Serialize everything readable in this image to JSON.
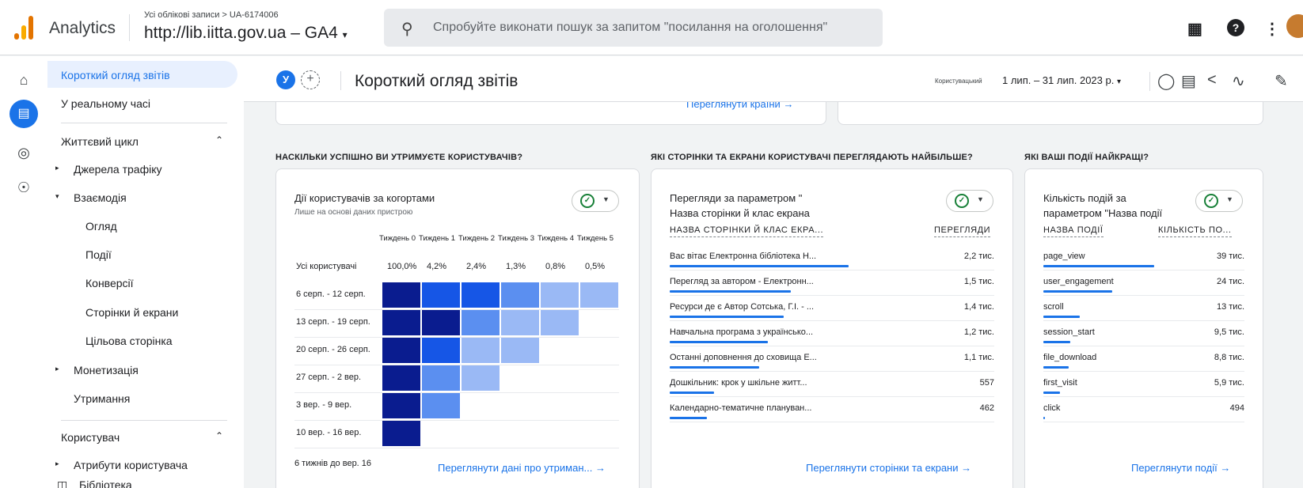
{
  "topbar": {
    "app_name": "Analytics",
    "breadcrumb": "Усі облікові записи > UA-6174006",
    "property": "http://lib.iitta.gov.ua – GA4",
    "search_placeholder": "Спробуйте виконати пошук за запитом \"посилання на оголошення\""
  },
  "sidebar": {
    "items": [
      {
        "label": "Короткий огляд звітів"
      },
      {
        "label": "У реальному часі"
      },
      {
        "label": "Життєвий цикл"
      },
      {
        "label": "Джерела трафіку"
      },
      {
        "label": "Взаємодія"
      },
      {
        "label": "Огляд"
      },
      {
        "label": "Події"
      },
      {
        "label": "Конверсії"
      },
      {
        "label": "Сторінки й екрани"
      },
      {
        "label": "Цільова сторінка"
      },
      {
        "label": "Монетизація"
      },
      {
        "label": "Утримання"
      },
      {
        "label": "Користувач"
      },
      {
        "label": "Атрибути користувача"
      },
      {
        "label": "Бібліотека"
      }
    ]
  },
  "header": {
    "chip_letter": "У",
    "title": "Короткий огляд звітів",
    "custom_label": "Користувацький",
    "date_range": "1 лип. – 31 лип. 2023 р."
  },
  "top_link": "Переглянути країни",
  "sections": {
    "retention": "НАСКІЛЬКИ УСПІШНО ВИ УТРИМУЄТЕ КОРИСТУВАЧІВ?",
    "pages": "ЯКІ СТОРІНКИ ТА ЕКРАНИ КОРИСТУВАЧІ ПЕРЕГЛЯДАЮТЬ НАЙБІЛЬШЕ?",
    "events": "ЯКІ ВАШІ ПОДІЇ НАЙКРАЩІ?"
  },
  "cohort": {
    "title": "Дії користувачів за когортами",
    "subtitle": "Лише на основі даних пристрою",
    "week_labels": [
      "Тиждень 0",
      "Тиждень 1",
      "Тиждень 2",
      "Тиждень 3",
      "Тиждень 4",
      "Тиждень 5"
    ],
    "all_users_label": "Усі користувачі",
    "all_users_pct": [
      "100,0%",
      "4,2%",
      "2,4%",
      "1,3%",
      "0,8%",
      "0,5%"
    ],
    "cohort_rows": [
      {
        "label": "6 серп. - 12 серп.",
        "shades": [
          0,
          1,
          1,
          2,
          3,
          3
        ]
      },
      {
        "label": "13 серп. - 19 серп.",
        "shades": [
          0,
          0,
          2,
          3,
          3
        ]
      },
      {
        "label": "20 серп. - 26 серп.",
        "shades": [
          0,
          1,
          3,
          3
        ]
      },
      {
        "label": "27 серп. - 2 вер.",
        "shades": [
          0,
          2,
          3
        ]
      },
      {
        "label": "3 вер. - 9 вер.",
        "shades": [
          0,
          2
        ]
      },
      {
        "label": "10 вер. - 16 вер.",
        "shades": [
          0
        ]
      }
    ],
    "shade_colors": [
      "#0a1c8f",
      "#1656e6",
      "#5b8ff0",
      "#9ab9f5"
    ],
    "footer_note": "6 тижнів до вер. 16",
    "link": "Переглянути дані про утриман..."
  },
  "pages_card": {
    "title_line1": "Перегляди за параметром \"",
    "title_line2": "Назва сторінки й клас екрана",
    "col1": "НАЗВА СТОРІНКИ Й КЛАС ЕКРА...",
    "col2": "ПЕРЕГЛЯДИ",
    "rows": [
      {
        "label": "Вас вітає Електронна бібліотека Н...",
        "value": "2,2 тис.",
        "share": 1.0
      },
      {
        "label": "Перегляд за автором - Електронн...",
        "value": "1,5 тис.",
        "share": 0.68
      },
      {
        "label": "Ресурси де є Автор Сотська, Г.І. - ...",
        "value": "1,4 тис.",
        "share": 0.64
      },
      {
        "label": "Навчальна програма з українсько...",
        "value": "1,2 тис.",
        "share": 0.55
      },
      {
        "label": "Останні доповнення до сховища Е...",
        "value": "1,1 тис.",
        "share": 0.5
      },
      {
        "label": "Дошкільник: крок у шкільне житт...",
        "value": "557",
        "share": 0.25
      },
      {
        "label": "Календарно-тематичне плануван...",
        "value": "462",
        "share": 0.21
      }
    ],
    "link": "Переглянути сторінки та екрани"
  },
  "events_card": {
    "title_line1": "Кількість подій за",
    "title_line2": "параметром \"Назва події",
    "col1": "НАЗВА ПОДІЇ",
    "col2": "КІЛЬКІСТЬ ПО...",
    "rows": [
      {
        "label": "page_view",
        "value": "39 тис.",
        "share": 1.0
      },
      {
        "label": "user_engagement",
        "value": "24 тис.",
        "share": 0.62
      },
      {
        "label": "scroll",
        "value": "13 тис.",
        "share": 0.33
      },
      {
        "label": "session_start",
        "value": "9,5 тис.",
        "share": 0.24
      },
      {
        "label": "file_download",
        "value": "8,8 тис.",
        "share": 0.23
      },
      {
        "label": "first_visit",
        "value": "5,9 тис.",
        "share": 0.15
      },
      {
        "label": "click",
        "value": "494",
        "share": 0.013
      }
    ],
    "link": "Переглянути події"
  },
  "colors": {
    "accent": "#1a73e8",
    "check": "#188038"
  }
}
